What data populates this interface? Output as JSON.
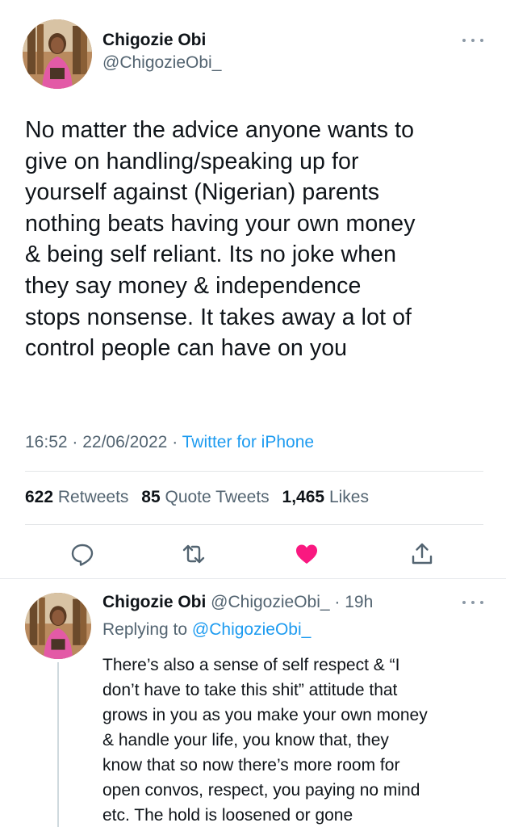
{
  "tweet": {
    "author": {
      "display_name": "Chigozie Obi",
      "handle": "@ChigozieObi_"
    },
    "text": "No matter the advice anyone wants to\ngive on handling/speaking up for\nyourself against (Nigerian) parents\nnothing beats having your own money\n& being self reliant. Its no joke when\nthey say money & independence\nstops nonsense. It takes away a lot of\ncontrol people can have on you",
    "time": "16:52",
    "date": "22/06/2022",
    "source": "Twitter for iPhone",
    "stats": {
      "retweets_count": "622",
      "retweets_label": "Retweets",
      "quotes_count": "85",
      "quotes_label": "Quote Tweets",
      "likes_count": "1,465",
      "likes_label": "Likes"
    },
    "liked": true
  },
  "reply": {
    "author": {
      "display_name": "Chigozie Obi",
      "handle": "@ChigozieObi_"
    },
    "age": "19h",
    "replying_to_label": "Replying to",
    "replying_to_handle": "@ChigozieObi_",
    "text": "There’s also a sense of self respect & “I\ndon’t have to take this shit” attitude that\ngrows in you as you make your own money\n& handle your life, you know that, they\nknow that so now there’s more room for\nopen convos, respect, you paying no mind\netc. The hold is loosened or gone"
  },
  "colors": {
    "text": "#0f1419",
    "secondary": "#536471",
    "accent": "#1d9bf0",
    "like": "#f91880",
    "divider": "#e3e6e8"
  },
  "icons": [
    "more-icon",
    "reply-icon",
    "retweet-icon",
    "like-icon",
    "share-icon"
  ]
}
